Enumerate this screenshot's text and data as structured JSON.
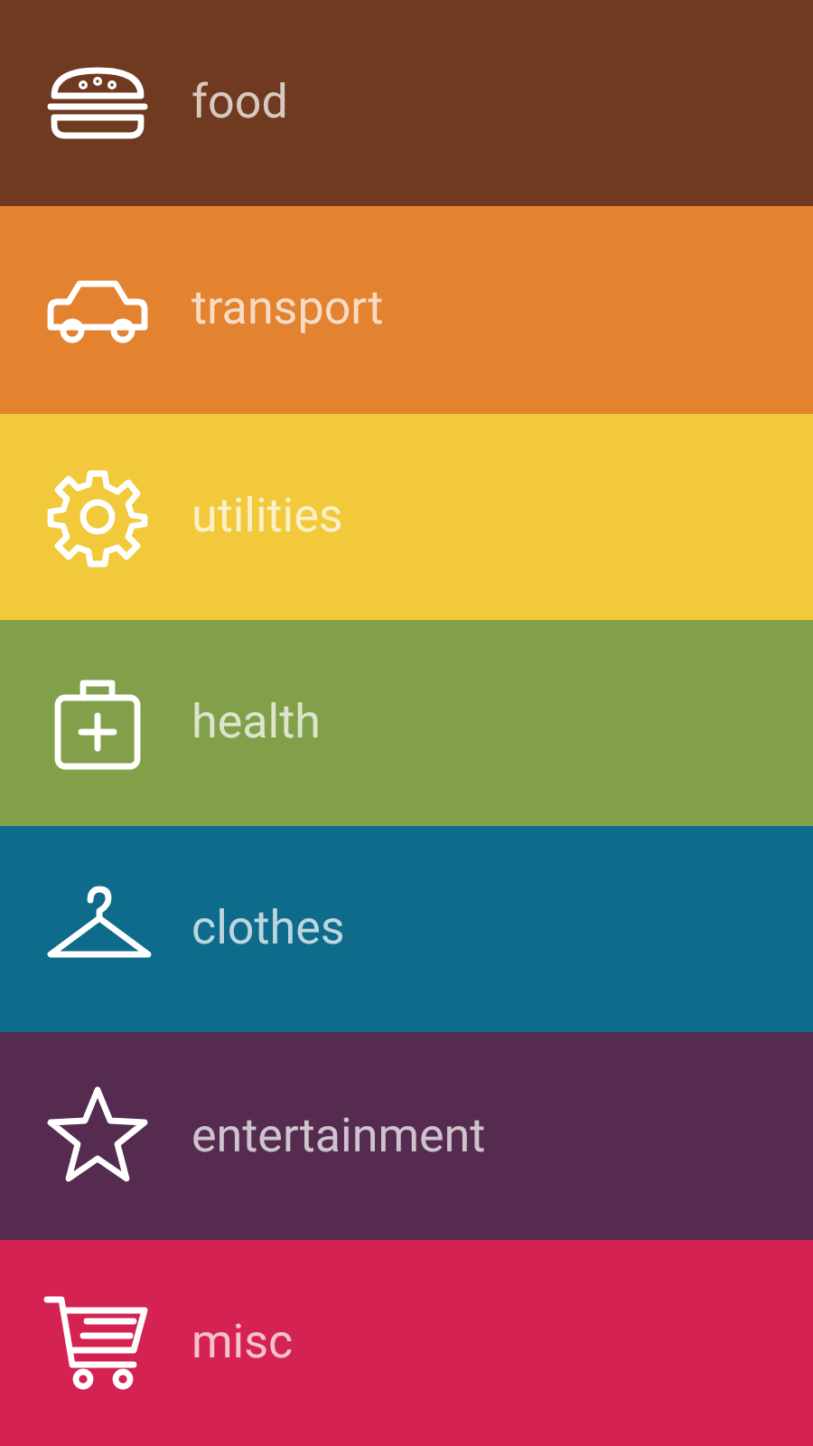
{
  "categories": [
    {
      "label": "food",
      "color": "#6f3a1f"
    },
    {
      "label": "transport",
      "color": "#e3822f"
    },
    {
      "label": "utilities",
      "color": "#f1c93a"
    },
    {
      "label": "health",
      "color": "#82a049"
    },
    {
      "label": "clothes",
      "color": "#0e6b8b"
    },
    {
      "label": "entertainment",
      "color": "#552c4f"
    },
    {
      "label": "misc",
      "color": "#d42352"
    }
  ]
}
